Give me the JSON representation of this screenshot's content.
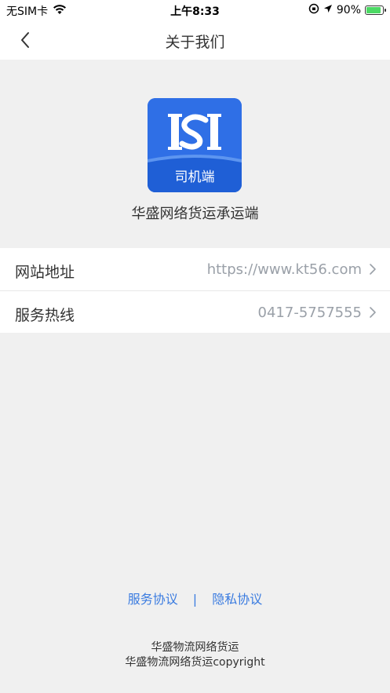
{
  "status_bar": {
    "carrier": "无SIM卡",
    "time": "上午8:33",
    "battery": "90%",
    "battery_level": 0.9
  },
  "nav": {
    "title": "关于我们",
    "back_icon": "chevron-left-icon"
  },
  "app": {
    "icon_label": "司机端",
    "name": "华盛网络货运承运端",
    "brand_color": "#2f6fe6"
  },
  "info": {
    "rows": [
      {
        "label": "网站地址",
        "value": "https://www.kt56.com"
      },
      {
        "label": "服务热线",
        "value": "0417-5757555"
      }
    ]
  },
  "links": {
    "service": "服务协议",
    "separator": "|",
    "privacy": "隐私协议"
  },
  "footer": {
    "line1": "华盛物流网络货运",
    "line2": "华盛物流网络货运copyright"
  }
}
